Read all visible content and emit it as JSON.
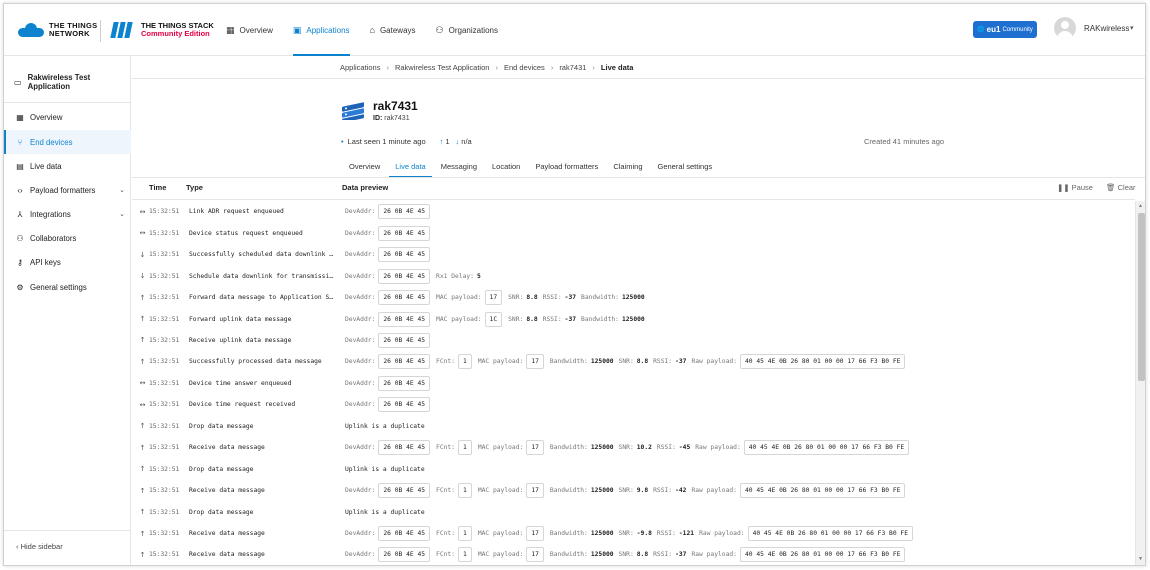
{
  "header": {
    "brand_ttn": [
      "THE THINGS",
      "NETWORK"
    ],
    "brand_stack": "THE THINGS STACK",
    "brand_edition": "Community Edition",
    "nav": [
      {
        "label": "Overview",
        "icon": "grid-icon"
      },
      {
        "label": "Applications",
        "icon": "applications-icon",
        "active": true
      },
      {
        "label": "Gateways",
        "icon": "gateway-icon"
      },
      {
        "label": "Organizations",
        "icon": "organizations-icon"
      }
    ],
    "v3_badge": {
      "prefix": "eu1",
      "label": "Community"
    },
    "user": "RAKwireless"
  },
  "sidebar": {
    "app_title": "Rakwireless Test Application",
    "items": [
      {
        "label": "Overview",
        "icon": "grid-icon"
      },
      {
        "label": "End devices",
        "icon": "devices-icon",
        "active": true
      },
      {
        "label": "Live data",
        "icon": "live-data-icon"
      },
      {
        "label": "Payload formatters",
        "icon": "code-icon",
        "expandable": true
      },
      {
        "label": "Integrations",
        "icon": "integrations-icon",
        "expandable": true
      },
      {
        "label": "Collaborators",
        "icon": "collaborators-icon"
      },
      {
        "label": "API keys",
        "icon": "key-icon"
      },
      {
        "label": "General settings",
        "icon": "gear-icon"
      }
    ],
    "hide_label": "Hide sidebar"
  },
  "breadcrumb": [
    "Applications",
    "Rakwireless Test Application",
    "End devices",
    "rak7431",
    "Live data"
  ],
  "device": {
    "name": "rak7431",
    "id_label": "ID:",
    "id": "rak7431",
    "last_seen": "Last seen 1 minute ago",
    "up_count": "1",
    "down_count": "n/a",
    "created": "Created 41 minutes ago"
  },
  "tabs": [
    "Overview",
    "Live data",
    "Messaging",
    "Location",
    "Payload formatters",
    "Claiming",
    "General settings"
  ],
  "live": {
    "col_time": "Time",
    "col_type": "Type",
    "col_preview": "Data preview",
    "pause": "Pause",
    "clear": "Clear",
    "rows": [
      {
        "dir": "↔",
        "time": "15:32:51",
        "type": "Link ADR request enqueued",
        "preview": [
          {
            "l": "DevAddr:",
            "b": "26 0B 4E 45"
          }
        ]
      },
      {
        "dir": "↔",
        "time": "15:32:51",
        "type": "Device status request enqueued",
        "preview": [
          {
            "l": "DevAddr:",
            "b": "26 0B 4E 45"
          }
        ]
      },
      {
        "dir": "↓",
        "time": "15:32:51",
        "type": "Successfully scheduled data downlink …",
        "preview": [
          {
            "l": "DevAddr:",
            "b": "26 0B 4E 45"
          }
        ]
      },
      {
        "dir": "↓",
        "time": "15:32:51",
        "type": "Schedule data downlink for transmissi…",
        "preview": [
          {
            "l": "DevAddr:",
            "b": "26 0B 4E 45"
          },
          {
            "k": "Rx1 Delay:",
            "v": "5"
          }
        ]
      },
      {
        "dir": "↑",
        "time": "15:32:51",
        "type": "Forward data message to Application S…",
        "preview": [
          {
            "l": "DevAddr:",
            "b": "26 0B 4E 45"
          },
          {
            "l": "MAC payload:",
            "b": "17"
          },
          {
            "k": "SNR:",
            "v": "8.8"
          },
          {
            "k": "RSSI:",
            "v": "-37"
          },
          {
            "k": "Bandwidth:",
            "v": "125000"
          }
        ]
      },
      {
        "dir": "↑",
        "time": "15:32:51",
        "type": "Forward uplink data message",
        "preview": [
          {
            "l": "DevAddr:",
            "b": "26 0B 4E 45"
          },
          {
            "l": "MAC payload:",
            "b": "1C"
          },
          {
            "k": "SNR:",
            "v": "8.8"
          },
          {
            "k": "RSSI:",
            "v": "-37"
          },
          {
            "k": "Bandwidth:",
            "v": "125000"
          }
        ]
      },
      {
        "dir": "↑",
        "time": "15:32:51",
        "type": "Receive uplink data message",
        "preview": [
          {
            "l": "DevAddr:",
            "b": "26 0B 4E 45"
          }
        ]
      },
      {
        "dir": "↑",
        "time": "15:32:51",
        "type": "Successfully processed data message",
        "preview": [
          {
            "l": "DevAddr:",
            "b": "26 0B 4E 45"
          },
          {
            "l": "FCnt:",
            "b": "1"
          },
          {
            "l": "MAC payload:",
            "b": "17"
          },
          {
            "k": "Bandwidth:",
            "v": "125000"
          },
          {
            "k": "SNR:",
            "v": "8.8"
          },
          {
            "k": "RSSI:",
            "v": "-37"
          },
          {
            "l": "Raw payload:",
            "b": "40 45 4E 0B 26 80 01 00 00 17 66 F3 B0 FE"
          }
        ]
      },
      {
        "dir": "↔",
        "time": "15:32:51",
        "type": "Device time answer enqueued",
        "preview": [
          {
            "l": "DevAddr:",
            "b": "26 0B 4E 45"
          }
        ]
      },
      {
        "dir": "↔",
        "time": "15:32:51",
        "type": "Device time request received",
        "preview": [
          {
            "l": "DevAddr:",
            "b": "26 0B 4E 45"
          }
        ]
      },
      {
        "dir": "↑",
        "time": "15:32:51",
        "type": "Drop data message",
        "preview": [
          {
            "t": "Uplink is a duplicate"
          }
        ]
      },
      {
        "dir": "↑",
        "time": "15:32:51",
        "type": "Receive data message",
        "preview": [
          {
            "l": "DevAddr:",
            "b": "26 0B 4E 45"
          },
          {
            "l": "FCnt:",
            "b": "1"
          },
          {
            "l": "MAC payload:",
            "b": "17"
          },
          {
            "k": "Bandwidth:",
            "v": "125000"
          },
          {
            "k": "SNR:",
            "v": "10.2"
          },
          {
            "k": "RSSI:",
            "v": "-45"
          },
          {
            "l": "Raw payload:",
            "b": "40 45 4E 0B 26 80 01 00 00 17 66 F3 B0 FE"
          }
        ]
      },
      {
        "dir": "↑",
        "time": "15:32:51",
        "type": "Drop data message",
        "preview": [
          {
            "t": "Uplink is a duplicate"
          }
        ]
      },
      {
        "dir": "↑",
        "time": "15:32:51",
        "type": "Receive data message",
        "preview": [
          {
            "l": "DevAddr:",
            "b": "26 0B 4E 45"
          },
          {
            "l": "FCnt:",
            "b": "1"
          },
          {
            "l": "MAC payload:",
            "b": "17"
          },
          {
            "k": "Bandwidth:",
            "v": "125000"
          },
          {
            "k": "SNR:",
            "v": "9.8"
          },
          {
            "k": "RSSI:",
            "v": "-42"
          },
          {
            "l": "Raw payload:",
            "b": "40 45 4E 0B 26 80 01 00 00 17 66 F3 B0 FE"
          }
        ]
      },
      {
        "dir": "↑",
        "time": "15:32:51",
        "type": "Drop data message",
        "preview": [
          {
            "t": "Uplink is a duplicate"
          }
        ]
      },
      {
        "dir": "↑",
        "time": "15:32:51",
        "type": "Receive data message",
        "preview": [
          {
            "l": "DevAddr:",
            "b": "26 0B 4E 45"
          },
          {
            "l": "FCnt:",
            "b": "1"
          },
          {
            "l": "MAC payload:",
            "b": "17"
          },
          {
            "k": "Bandwidth:",
            "v": "125000"
          },
          {
            "k": "SNR:",
            "v": "-9.8"
          },
          {
            "k": "RSSI:",
            "v": "-121"
          },
          {
            "l": "Raw payload:",
            "b": "40 45 4E 0B 26 80 01 00 00 17 66 F3 B0 FE"
          }
        ]
      },
      {
        "dir": "↑",
        "time": "15:32:51",
        "type": "Receive data message",
        "preview": [
          {
            "l": "DevAddr:",
            "b": "26 0B 4E 45"
          },
          {
            "l": "FCnt:",
            "b": "1"
          },
          {
            "l": "MAC payload:",
            "b": "17"
          },
          {
            "k": "Bandwidth:",
            "v": "125000"
          },
          {
            "k": "SNR:",
            "v": "8.8"
          },
          {
            "k": "RSSI:",
            "v": "-37"
          },
          {
            "l": "Raw payload:",
            "b": "40 45 4E 0B 26 80 01 00 00 17 66 F3 B0 FE"
          }
        ]
      }
    ]
  },
  "colors": {
    "accent": "#0d83d0",
    "brand_red": "#e40046",
    "v3_button": "#1f6fd0"
  }
}
